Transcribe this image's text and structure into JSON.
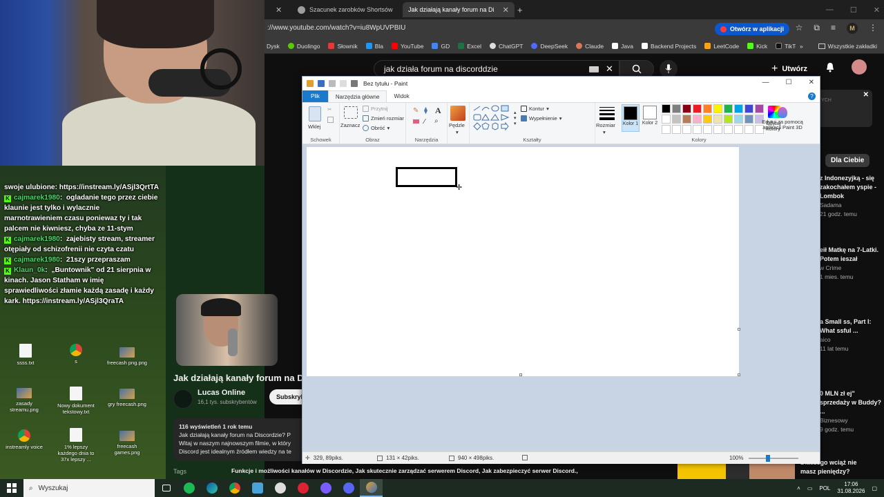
{
  "browser": {
    "tabs": [
      {
        "label": "Szacunek zarobków Shortsów"
      },
      {
        "label": "Jak działają kanały forum na Di"
      }
    ],
    "url": "://www.youtube.com/watch?v=iu8WpUVPBIU",
    "open_in_app": "Otwórz w aplikacji",
    "bookmarks": [
      "Dysk",
      "Duolingo",
      "Słownik",
      "Bla",
      "YouTube",
      "GD",
      "Excel",
      "ChatGPT",
      "DeepSeek",
      "Claude",
      "Java",
      "Backend Projects",
      "LeetCode",
      "Kick",
      "TikTok"
    ],
    "all_bookmarks": "Wszystkie zakładki",
    "profile_letter": "M"
  },
  "youtube": {
    "search_query": "jak działa forum na discorddzie",
    "create_label": "Utwórz",
    "chip_dla_ciebie": "Dla Ciebie",
    "recs": [
      {
        "title": "z Indonezyjką - się zakochałem yspie - Lombok",
        "meta1": "Sadama",
        "meta2": "21 godz. temu"
      },
      {
        "title": "eił Matkę na 7-Latki. Potem ieszał",
        "meta1": "w Crime",
        "meta2": "1 mies. temu"
      },
      {
        "title": "a Small ss, Part I: What ssful ...",
        "meta1": "aico",
        "meta2": "11 lat temu"
      },
      {
        "title": "0 MLN zł ej\" sprzedaży w Buddy? ...",
        "meta1": "Biznesowy",
        "meta2": "9 godz. temu"
      }
    ],
    "rec_bottom": "Dlaczego wciąż nie masz pieniędzy?",
    "ich_label": "YCH",
    "video_title": "Jak działają kanały forum na Di",
    "channel_name": "Lucas Online",
    "channel_subs": "16,1 tys. subskrybentów",
    "subscribe": "Subskryb",
    "views": "116 wyświetleń  1 rok temu",
    "desc_line1": "Jak działają kanały forum na Discordzie? P",
    "desc_line2": "Witaj w naszym najnowszym filmie, w który",
    "desc_line3": "Discord jest idealnym źródłem wiedzy na te",
    "tags_label": "Tags",
    "tags": "Funkcje i możliwości kanałów w Discordzie, Jak skutecznie zarządzać serwerem Discord, Jak zabezpieczyć serwer Discord.,"
  },
  "chat": [
    {
      "user": "",
      "text": "swoje ulubione: https://instream.ly/ASjl3QrtTA"
    },
    {
      "user": "cajmarek1980",
      "text": "ogladanie tego przez ciebie klaunie jest tylko i wylacznie marnotrawieniem czasu poniewaz ty i tak palcem nie kiwniesz, chyba ze 11-stym"
    },
    {
      "user": "cajmarek1980",
      "text": "zajebisty stream, streamer otępiały od schizofrenii nie czyta czatu"
    },
    {
      "user": "cajmarek1980",
      "text": "21szy przepraszam"
    },
    {
      "user": "Klaun_0k",
      "text": "„Buntownik\" od 21 sierpnia w kinach. Jason Statham w imię sprawiedliwości złamie każdą zasadę i każdy kark. https://instream.ly/ASjl3QraTA"
    }
  ],
  "desktop_icons": [
    {
      "label": "ssss.txt",
      "type": "doc"
    },
    {
      "label": "s",
      "type": "chrome"
    },
    {
      "label": "freecash png.png",
      "type": "img"
    },
    {
      "label": "zasady streamu.png",
      "type": "img"
    },
    {
      "label": "Nowy dokument tekstowy.txt",
      "type": "doc"
    },
    {
      "label": "gry freecash.png",
      "type": "img"
    },
    {
      "label": "instreamly voice",
      "type": "chrome"
    },
    {
      "label": "1% lepszy każdego dnia to 37x lepszy ...",
      "type": "doc"
    },
    {
      "label": "freecash games.png",
      "type": "img"
    }
  ],
  "paint": {
    "title": "Bez tytułu - Paint",
    "tabs": [
      "Plik",
      "Narzędzia główne",
      "Widok"
    ],
    "groups": {
      "schowek": "Schowek",
      "obraz": "Obraz",
      "narzedzia": "Narzędzia",
      "ksztalty": "Kształty",
      "kolory": "Kolory"
    },
    "wklej": "Wklej",
    "zaznacz": "Zaznacz",
    "przytnij": "Przytnij",
    "zmien_rozmiar": "Zmień rozmiar",
    "obroc": "Obróć",
    "pedzle": "Pędzle",
    "kontur": "Kontur",
    "wypelnienie": "Wypełnienie",
    "rozmiar": "Rozmiar",
    "kolor1": "Kolor 1",
    "kolor2": "Kolor 2",
    "edytuj_kolory": "Edytuj kolory",
    "paint3d": "Edytuj za pomocą aplikacji Paint 3D",
    "palette": [
      "#000000",
      "#7f7f7f",
      "#880015",
      "#ed1c24",
      "#ff7f27",
      "#fff200",
      "#22b14c",
      "#00a2e8",
      "#3f48cc",
      "#a349a4",
      "#ffffff",
      "#c3c3c3",
      "#b97a57",
      "#ffaec9",
      "#ffc90e",
      "#efe4b0",
      "#b5e61d",
      "#99d9ea",
      "#7092be",
      "#c8bfe7",
      "#ffffff",
      "#ffffff",
      "#ffffff",
      "#ffffff",
      "#ffffff",
      "#ffffff",
      "#ffffff",
      "#ffffff",
      "#ffffff",
      "#ffffff"
    ],
    "status_pos": "329, 89piks.",
    "status_sel": "131 × 42piks.",
    "status_size": "940 × 498piks.",
    "zoom": "100%"
  },
  "taskbar": {
    "search": "Wyszukaj",
    "lang": "POL",
    "time": "17:06",
    "date": "31.08.2026"
  }
}
